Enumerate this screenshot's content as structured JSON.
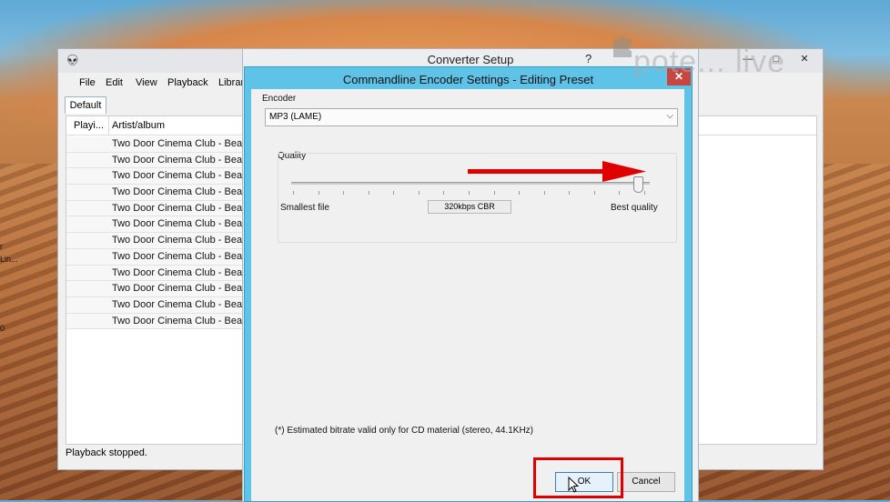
{
  "desktop": {
    "fragments": [
      "r",
      "Lin...",
      "0"
    ]
  },
  "foobar": {
    "menu": [
      "File",
      "Edit",
      "View",
      "Playback",
      "Librar"
    ],
    "tab": "Default",
    "columns": [
      "Playi...",
      "Artist/album"
    ],
    "rows": [
      "Two Door Cinema Club - Beaco",
      "Two Door Cinema Club - Beaco",
      "Two Door Cinema Club - Beaco",
      "Two Door Cinema Club - Beaco",
      "Two Door Cinema Club - Beaco",
      "Two Door Cinema Club - Beaco",
      "Two Door Cinema Club - Beaco",
      "Two Door Cinema Club - Beaco",
      "Two Door Cinema Club - Beaco",
      "Two Door Cinema Club - Beaco",
      "Two Door Cinema Club - Beaco",
      "Two Door Cinema Club - Beaco"
    ],
    "status": "Playback stopped.",
    "window_buttons": [
      "—",
      "□",
      "✕"
    ]
  },
  "converter": {
    "title": "Converter Setup",
    "help": "?"
  },
  "dialog": {
    "title": "Commandline Encoder Settings - Editing Preset",
    "close": "✕",
    "encoder_label": "Encoder",
    "encoder_value": "MP3 (LAME)",
    "combo_arrow": "⌵",
    "quality_label": "Quality",
    "quality_min": "Smallest file",
    "quality_max": "Best quality",
    "quality_value": "320kbps CBR",
    "quality_level": 1.0,
    "footnote": "(*) Estimated bitrate valid only for CD material (stereo, 44.1KHz)",
    "ok": "OK",
    "cancel": "Cancel"
  },
  "watermark": {
    "text": "pote... live"
  },
  "colors": {
    "dialog_frame": "#5fc2e7",
    "close_button": "#c7463f",
    "annotation": "#e00000"
  },
  "icons": [
    "alien-logo-icon",
    "close-icon",
    "chevron-down-icon",
    "mouse-cursor-icon",
    "puzzle-icon"
  ]
}
